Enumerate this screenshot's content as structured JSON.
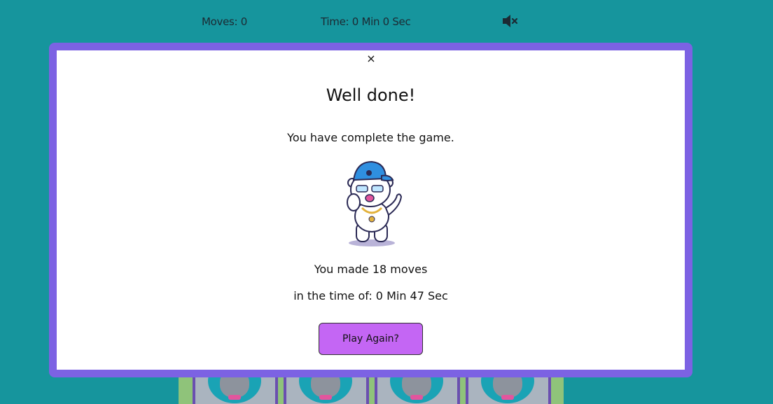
{
  "status": {
    "moves_text": "Moves: 0",
    "time_text": "Time: 0 Min 0 Sec",
    "sound_icon": "volume-mute-icon"
  },
  "modal": {
    "close_label": "×",
    "title": "Well done!",
    "subtitle": "You have complete the game.",
    "image_icon": "polar-bear-mascot",
    "moves_result": "You made 18 moves",
    "time_result": "in the time of: 0 Min 47 Sec",
    "play_again_label": "Play Again?"
  },
  "board": {
    "visible_cards": 4,
    "card_icon": "polar-bear-card-back"
  },
  "colors": {
    "background": "#16959d",
    "modal_border": "#7c62e3",
    "button": "#c466f4"
  }
}
